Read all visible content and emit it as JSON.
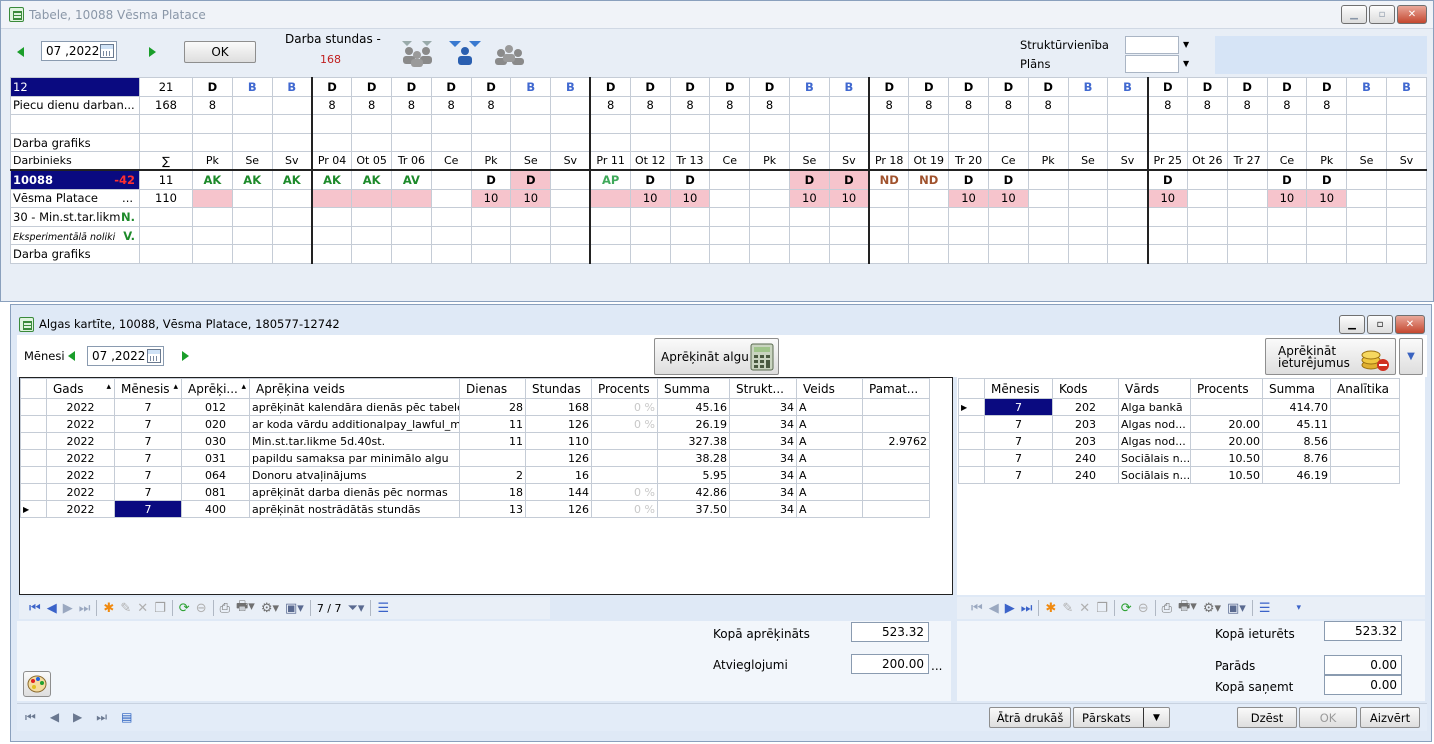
{
  "tabele": {
    "title": "Tabele, 10088 Vēsma Platace",
    "period": "07 ,2022",
    "ok": "OK",
    "hours_label": "Darba stundas -",
    "hours_value": "168",
    "struct_label": "Struktūrvienība",
    "plan_label": "Plāns",
    "top_rows": [
      {
        "label": "12",
        "sum": "21",
        "cells": [
          "D",
          "B",
          "B",
          "D",
          "D",
          "D",
          "D",
          "D",
          "B",
          "B",
          "D",
          "D",
          "D",
          "D",
          "D",
          "B",
          "B",
          "D",
          "D",
          "D",
          "D",
          "D",
          "B",
          "B",
          "D",
          "D",
          "D",
          "D",
          "D",
          "B",
          "B"
        ]
      },
      {
        "label": "Piecu dienu darban...",
        "sum": "168",
        "cells": [
          "8",
          "",
          "",
          "8",
          "8",
          "8",
          "8",
          "8",
          "",
          "",
          "8",
          "8",
          "8",
          "8",
          "8",
          "",
          "",
          "8",
          "8",
          "8",
          "8",
          "8",
          "",
          "",
          "8",
          "8",
          "8",
          "8",
          "8",
          "",
          ""
        ]
      },
      {
        "label": "",
        "sum": "",
        "cells": []
      },
      {
        "label": "Darba grafiks",
        "sum": "",
        "cells": []
      }
    ],
    "day_header_label": "Darbinieks",
    "day_header_sum": "∑",
    "days": [
      "Pk",
      "Se",
      "Sv",
      "Pr 04",
      "Ot 05",
      "Tr 06",
      "Ce",
      "Pk",
      "Se",
      "Sv",
      "Pr 11",
      "Ot 12",
      "Tr 13",
      "Ce",
      "Pk",
      "Se",
      "Sv",
      "Pr 18",
      "Ot 19",
      "Tr 20",
      "Ce",
      "Pk",
      "Se",
      "Sv",
      "Pr 25",
      "Ot 26",
      "Tr 27",
      "Ce",
      "Pk",
      "Se",
      "Sv"
    ],
    "emp_row1": {
      "id": "10088",
      "neg": "-42",
      "sum": "11",
      "cells": [
        "AK",
        "AK",
        "AK",
        "AK",
        "AK",
        "AV",
        "",
        "D",
        "D",
        "",
        "AP",
        "D",
        "D",
        "",
        "",
        "D",
        "D",
        "ND",
        "ND",
        "D",
        "D",
        "",
        "",
        "",
        "D",
        "",
        "",
        "D",
        "D",
        "",
        ""
      ]
    },
    "emp_row2": {
      "name": "Vēsma Platace",
      "dots": "...",
      "sum": "110",
      "cells": [
        "",
        "",
        "",
        "",
        "",
        "",
        "",
        "10",
        "10",
        "",
        "",
        "10",
        "10",
        "",
        "",
        "10",
        "10",
        "",
        "",
        "10",
        "10",
        "",
        "",
        "",
        "10",
        "",
        "",
        "10",
        "10",
        "",
        ""
      ]
    },
    "emp_row3": {
      "label": "30 - Min.st.tar.likm",
      "flag": "N."
    },
    "emp_row4": {
      "label": "Eksperimentālā noliki",
      "flag": "V."
    },
    "emp_row5": {
      "label": "Darba grafiks"
    }
  },
  "alga": {
    "title": "Algas kartīte, 10088, Vēsma Platace, 180577-12742",
    "month_label": "Mēnesi",
    "period": "07 ,2022",
    "calc_btn": "Aprēķināt algu",
    "calc_ded_btn_1": "Aprēķināt",
    "calc_ded_btn_2": "ieturējumus",
    "left_headers": [
      "Gads",
      "Mēnesis",
      "Aprēķi...",
      "Aprēķina veids",
      "Dienas",
      "Stundas",
      "Procents",
      "Summa",
      "Strukt...",
      "Veids",
      "Pamat..."
    ],
    "left_rows": [
      [
        "2022",
        "7",
        "012",
        "aprēķināt kalendāra dienās pēc tabeles",
        "28",
        "168",
        "0 %",
        "45.16",
        "34",
        "A",
        ""
      ],
      [
        "2022",
        "7",
        "020",
        "ar koda vārdu additionalpay_lawful_minus",
        "11",
        "126",
        "0 %",
        "26.19",
        "34",
        "A",
        ""
      ],
      [
        "2022",
        "7",
        "030",
        "Min.st.tar.likme 5d.40st.",
        "11",
        "110",
        "",
        "327.38",
        "34",
        "A",
        "2.9762"
      ],
      [
        "2022",
        "7",
        "031",
        "papildu samaksa par minimālo algu",
        "",
        "126",
        "",
        "38.28",
        "34",
        "A",
        ""
      ],
      [
        "2022",
        "7",
        "064",
        "Donoru atvaļinājums",
        "2",
        "16",
        "",
        "5.95",
        "34",
        "A",
        ""
      ],
      [
        "2022",
        "7",
        "081",
        "aprēķināt darba dienās pēc normas",
        "18",
        "144",
        "0 %",
        "42.86",
        "34",
        "A",
        ""
      ],
      [
        "2022",
        "7",
        "400",
        "aprēķināt nostrādātās stundās",
        "13",
        "126",
        "0 %",
        "37.50",
        "34",
        "A",
        ""
      ]
    ],
    "right_headers": [
      "Mēnesis",
      "Kods",
      "Vārds",
      "Procents",
      "Summa",
      "Analītika"
    ],
    "right_rows": [
      [
        "7",
        "202",
        "Alga bankā",
        "",
        "414.70",
        ""
      ],
      [
        "7",
        "203",
        "Algas nod...",
        "20.00",
        "45.11",
        ""
      ],
      [
        "7",
        "203",
        "Algas nod...",
        "20.00",
        "8.56",
        ""
      ],
      [
        "7",
        "240",
        "Sociālais n...",
        "10.50",
        "8.76",
        ""
      ],
      [
        "7",
        "240",
        "Sociālais n...",
        "10.50",
        "46.19",
        ""
      ]
    ],
    "nav_count": "7 / 7",
    "total_calc_label": "Kopā aprēķināts",
    "total_calc": "523.32",
    "relief_label": "Atvieglojumi",
    "relief": "200.00",
    "relief_more": "...",
    "total_ded_label": "Kopā ieturēts",
    "total_ded": "523.32",
    "debt_label": "Parāds",
    "debt": "0.00",
    "recv_label": "Kopā saņemt",
    "recv": "0.00",
    "btn_quick_print": "Ātrā drukāš",
    "btn_overview": "Pārskats",
    "btn_delete": "Dzēst",
    "btn_ok": "OK",
    "btn_close": "Aizvērt"
  }
}
